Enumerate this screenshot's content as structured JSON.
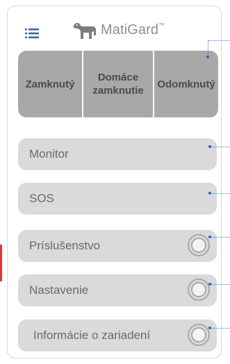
{
  "app": {
    "brand": "MatiGard",
    "trademark": "™"
  },
  "icons": {
    "menu": "hamburger-list-icon",
    "logo": "dog-logo-icon",
    "status": "ring-status-icon"
  },
  "modes": [
    {
      "label": "Zamknutý"
    },
    {
      "label": "Domáce zamknutie"
    },
    {
      "label": "Odomknutý"
    }
  ],
  "menu": [
    {
      "label": "Monitor"
    },
    {
      "label": "SOS"
    },
    {
      "label": "Príslušenstvo"
    },
    {
      "label": "Nastavenie"
    },
    {
      "label": "Informácie o zariadení"
    }
  ],
  "colors": {
    "mode_bar": "#a8a8a8",
    "button": "#dadada",
    "accent": "#d33b40",
    "callout": "#2f5fb8"
  }
}
